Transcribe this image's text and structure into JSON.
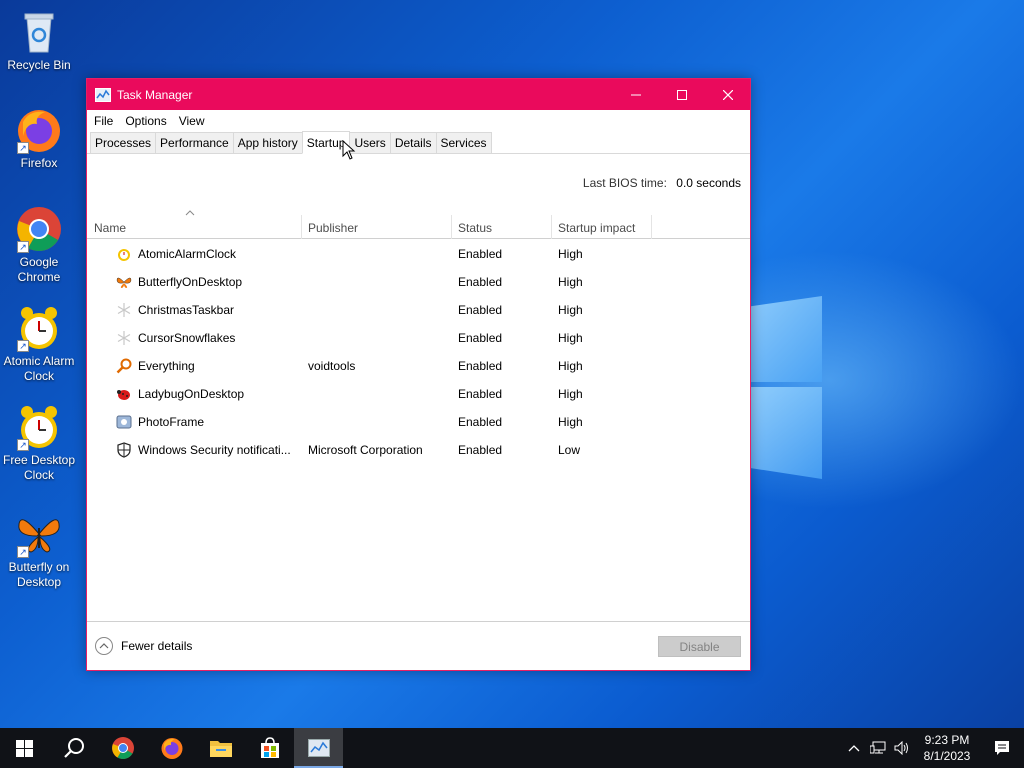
{
  "desktop": {
    "icons": [
      {
        "label": "Recycle Bin",
        "icon": "recycle-bin-icon"
      },
      {
        "label": "Firefox",
        "icon": "firefox-icon"
      },
      {
        "label": "Google Chrome",
        "icon": "chrome-icon"
      },
      {
        "label": "Atomic Alarm Clock",
        "icon": "alarm-clock-icon"
      },
      {
        "label": "Free Desktop Clock",
        "icon": "alarm-clock-icon"
      },
      {
        "label": "Butterfly on Desktop",
        "icon": "butterfly-icon"
      }
    ]
  },
  "window": {
    "title": "Task Manager",
    "accent": "#ea0a5c",
    "menu": [
      "File",
      "Options",
      "View"
    ],
    "tabs": [
      "Processes",
      "Performance",
      "App history",
      "Startup",
      "Users",
      "Details",
      "Services"
    ],
    "active_tab": "Startup",
    "bios_label": "Last BIOS time:",
    "bios_value": "0.0 seconds",
    "columns": [
      "Name",
      "Publisher",
      "Status",
      "Startup impact"
    ],
    "rows": [
      {
        "name": "AtomicAlarmClock",
        "publisher": "",
        "status": "Enabled",
        "impact": "High",
        "icon": "alarm-clock-icon"
      },
      {
        "name": "ButterflyOnDesktop",
        "publisher": "",
        "status": "Enabled",
        "impact": "High",
        "icon": "butterfly-icon"
      },
      {
        "name": "ChristmasTaskbar",
        "publisher": "",
        "status": "Enabled",
        "impact": "High",
        "icon": "snowflake-icon"
      },
      {
        "name": "CursorSnowflakes",
        "publisher": "",
        "status": "Enabled",
        "impact": "High",
        "icon": "snowflake-icon"
      },
      {
        "name": "Everything",
        "publisher": "voidtools",
        "status": "Enabled",
        "impact": "High",
        "icon": "magnifier-icon"
      },
      {
        "name": "LadybugOnDesktop",
        "publisher": "",
        "status": "Enabled",
        "impact": "High",
        "icon": "ladybug-icon"
      },
      {
        "name": "PhotoFrame",
        "publisher": "",
        "status": "Enabled",
        "impact": "High",
        "icon": "photo-frame-icon"
      },
      {
        "name": "Windows Security notificati...",
        "publisher": "Microsoft Corporation",
        "status": "Enabled",
        "impact": "Low",
        "icon": "shield-icon"
      }
    ],
    "fewer_details": "Fewer details",
    "disable_label": "Disable"
  },
  "taskbar": {
    "time": "9:23 PM",
    "date": "8/1/2023",
    "apps": [
      "windows-start-icon",
      "search-icon",
      "chrome-icon",
      "firefox-icon",
      "file-explorer-icon",
      "store-icon",
      "task-manager-icon"
    ]
  }
}
